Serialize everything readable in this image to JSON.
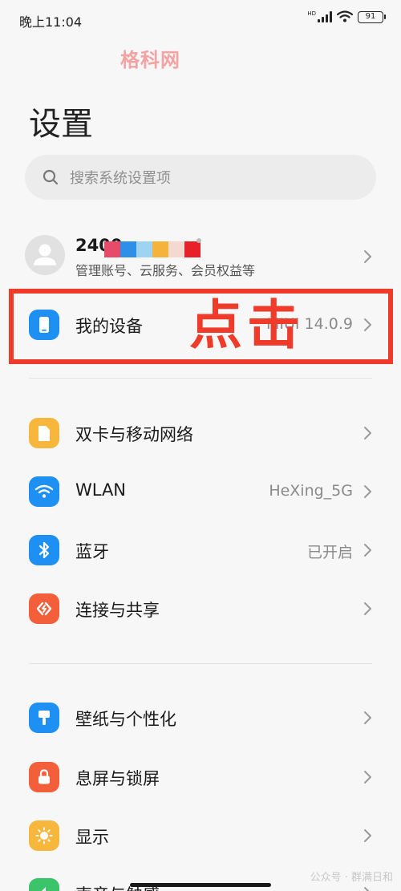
{
  "status_bar": {
    "time": "晚上11:04",
    "network": "HD",
    "battery": "91"
  },
  "watermark_top": "格科网",
  "page": {
    "title": "设置"
  },
  "search": {
    "placeholder": "搜索系统设置项"
  },
  "account": {
    "name": "2400",
    "subtitle": "管理账号、云服务、会员权益等"
  },
  "my_device": {
    "label": "我的设备",
    "value": "MIUI 14.0.9"
  },
  "annotation": {
    "text": "点击",
    "color": "#ee3b2a"
  },
  "settings": {
    "dual_sim": {
      "label": "双卡与移动网络",
      "icon": "sim-card-icon",
      "color": "#f6b73c"
    },
    "wlan": {
      "label": "WLAN",
      "value": "HeXing_5G",
      "icon": "wifi-icon",
      "color": "#1e90f4"
    },
    "bluetooth": {
      "label": "蓝牙",
      "value": "已开启",
      "icon": "bluetooth-icon",
      "color": "#1e90f4"
    },
    "connection": {
      "label": "连接与共享",
      "icon": "share-icon",
      "color": "#f25f3a"
    },
    "wallpaper": {
      "label": "壁纸与个性化",
      "icon": "brush-icon",
      "color": "#1e90f4"
    },
    "lockscreen": {
      "label": "息屏与锁屏",
      "icon": "lock-icon",
      "color": "#f25f3a"
    },
    "display": {
      "label": "显示",
      "icon": "sun-icon",
      "color": "#f6b73c"
    },
    "sound": {
      "label": "声音与触感",
      "icon": "speaker-icon",
      "color": "#3cc46b"
    }
  },
  "watermark_bottom": "公众号 · 群满日和"
}
